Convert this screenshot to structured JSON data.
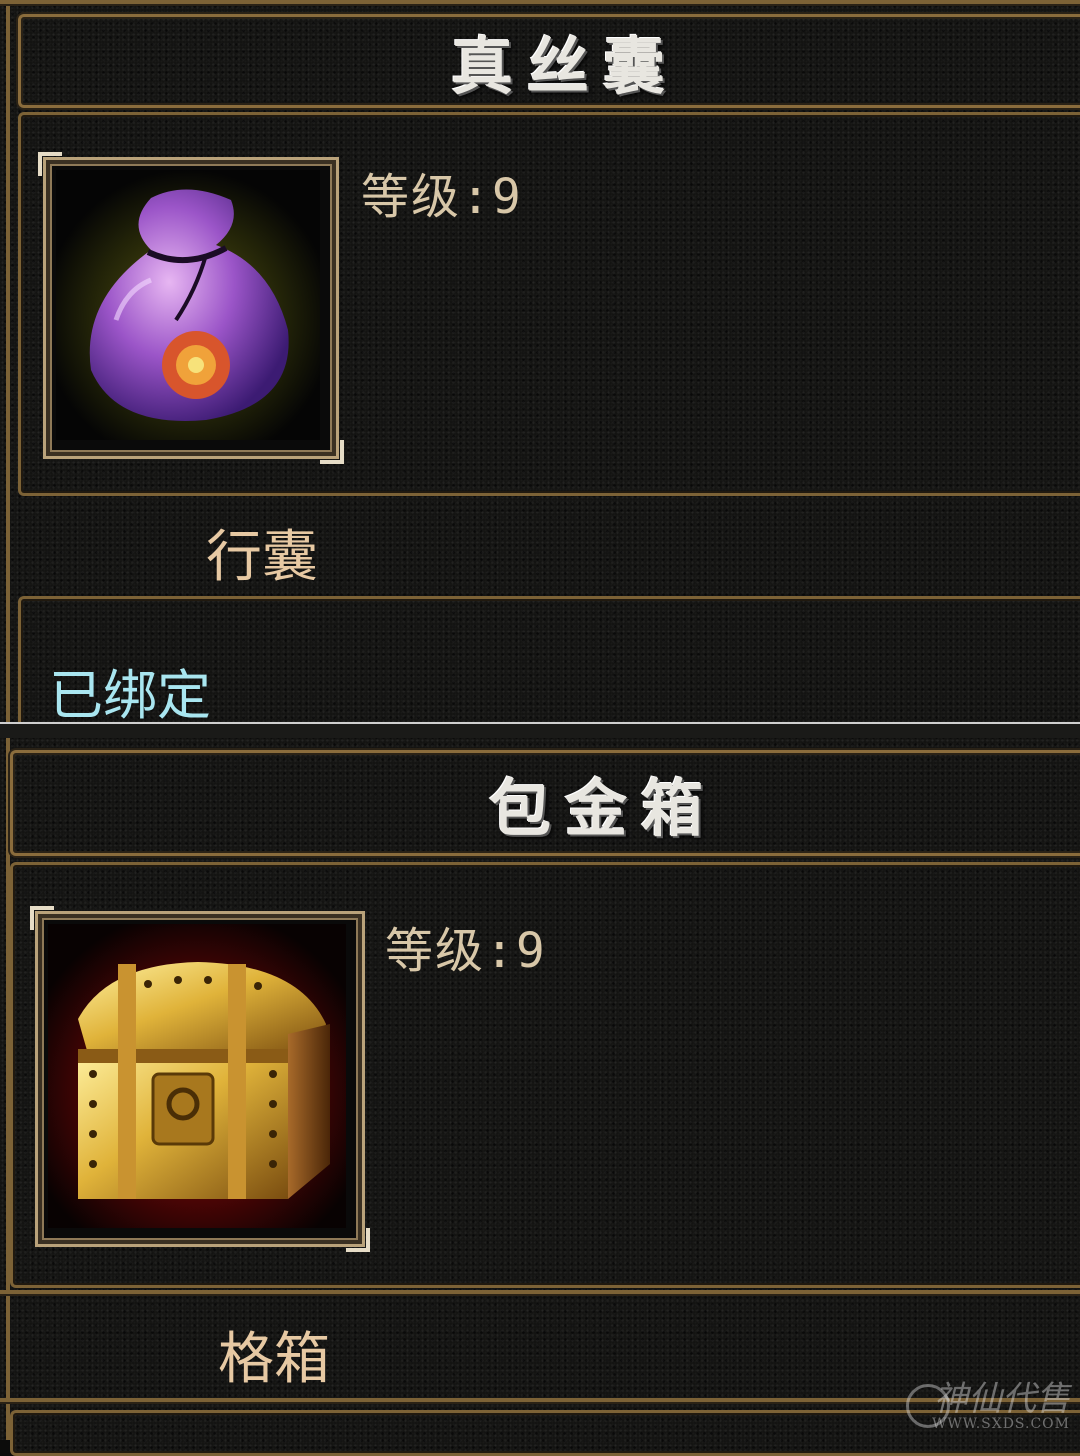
{
  "items": [
    {
      "name": "真丝囊",
      "level": "等级:9",
      "type": "行囊",
      "bind_status": "已绑定",
      "icon": "silk-pouch-icon"
    },
    {
      "name": "包金箱",
      "level": "等级:9",
      "type": "格箱",
      "icon": "gold-chest-icon"
    }
  ],
  "watermark": {
    "text": "神仙代售",
    "url": "WWW.SXDS.COM"
  },
  "colors": {
    "gold_border": "#7c6236",
    "level_text": "#d8c7a8",
    "type_text": "#e7c9a3",
    "bind_text": "#a9e6f0",
    "title_text": "#e8e6e0"
  }
}
